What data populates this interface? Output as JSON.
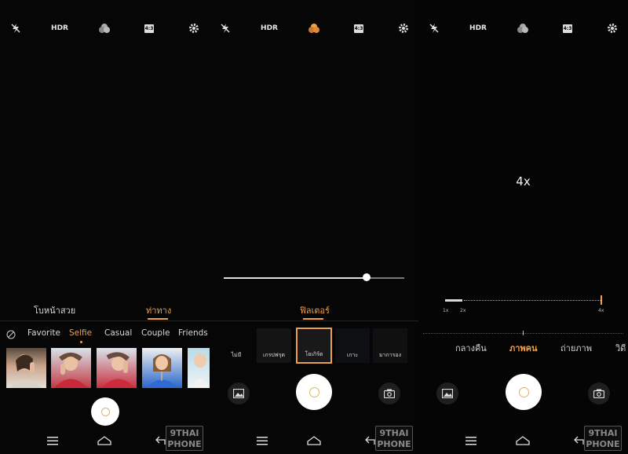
{
  "panels": [
    {
      "top_bar": {
        "flash_icon": "flash-off-icon",
        "hdr_label": "HDR",
        "filter_icon": "color-filter-icon",
        "ratio_label": "4:3",
        "settings_icon": "gear-icon"
      },
      "mode_tabs": [
        {
          "label": "โบหน้าสวย",
          "active": false
        },
        {
          "label": "ท่าทาง",
          "active": true
        }
      ],
      "pose_categories": [
        "Favorite",
        "Selfie",
        "Casual",
        "Couple",
        "Friends"
      ],
      "active_category": "Selfie",
      "nav": {
        "menu_icon": "menu-icon",
        "home_icon": "home-icon",
        "back_icon": "back-icon"
      },
      "watermark": {
        "line1": "9THAI",
        "line2": "PHONE"
      }
    },
    {
      "top_bar": {
        "flash_icon": "flash-off-icon",
        "hdr_label": "HDR",
        "filter_icon": "color-filter-icon",
        "ratio_label": "4:3",
        "settings_icon": "gear-icon"
      },
      "slider_value": 0.79,
      "mode_tab": "ฟิลเตอร์",
      "filters": [
        "ไม่มี",
        "เกรปฟรุต",
        "โยเกิร์ต",
        "เกาะ",
        "มาการอง"
      ],
      "selected_filter": "โยเกิร์ต",
      "nav": {
        "menu_icon": "menu-icon",
        "home_icon": "home-icon",
        "back_icon": "back-icon"
      },
      "watermark": {
        "line1": "9THAI",
        "line2": "PHONE"
      }
    },
    {
      "top_bar": {
        "flash_icon": "flash-off-icon",
        "hdr_label": "HDR",
        "filter_icon": "color-filter-icon",
        "ratio_label": "4:3",
        "settings_icon": "gear-icon"
      },
      "zoom_display": "4x",
      "zoom_labels": [
        "1x",
        "2x",
        "4x"
      ],
      "modes": [
        "กลางคืน",
        "ภาพคน",
        "ถ่ายภาพ",
        "วิดี"
      ],
      "active_mode": "ภาพคน",
      "nav": {
        "menu_icon": "menu-icon",
        "home_icon": "home-icon",
        "back_icon": "back-icon"
      },
      "watermark": {
        "line1": "9THAI",
        "line2": "PHONE"
      }
    }
  ],
  "colors": {
    "accent": "#f0a04b",
    "background": "#060606",
    "shutter": "#ffffff"
  }
}
